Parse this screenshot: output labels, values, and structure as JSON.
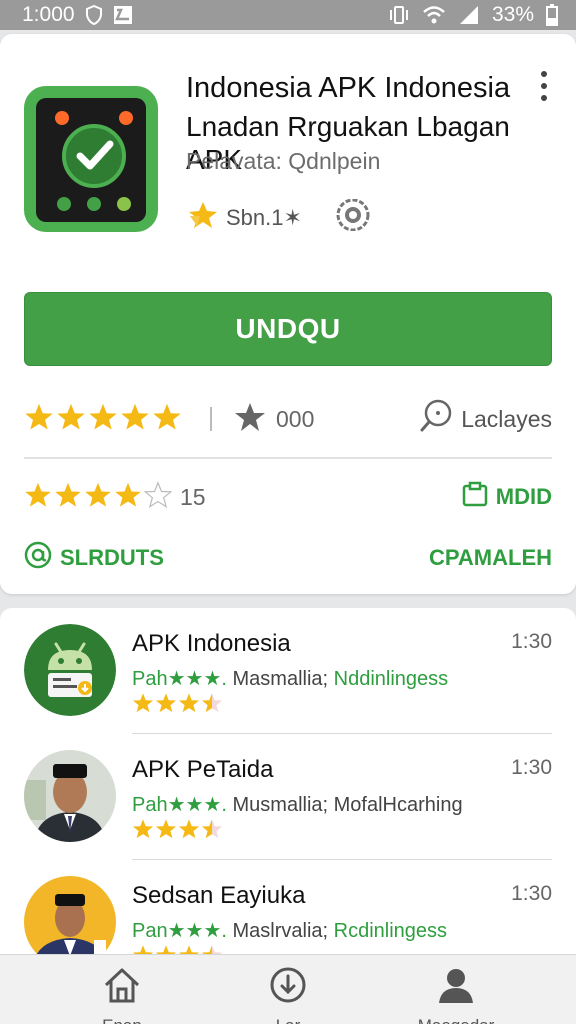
{
  "status_bar": {
    "time": "1:000",
    "battery": "33%"
  },
  "app": {
    "title": "Indonesia APK Indonesia",
    "subtitle": "Lnadan Rrguakan Lbagan APK",
    "publisher": "Pelavata:  Qdnlpein",
    "badge_text": "Sbn.1✶",
    "install_label": "UNDQU",
    "colors": {
      "accent": "#43a047",
      "link": "#2e9e3f",
      "star": "#f5b915"
    }
  },
  "ratings": {
    "primary_stars": 5,
    "primary_count": "000",
    "reviews_label": "Laclayes",
    "secondary_stars": 4,
    "secondary_count": "15",
    "right_link": "MDID",
    "left_link_2": "SLRDUTS",
    "right_link_2": "CPAMALEH"
  },
  "list": [
    {
      "title": "APK Indonesia",
      "time": "1:30",
      "meta_green": "Pah★★★.",
      "meta_mid": "Masmallia;",
      "meta_end": "Nddinlingess",
      "stars": 3.5,
      "avatar": "android-robot-icon"
    },
    {
      "title": "APK PeTaida",
      "time": "1:30",
      "meta_green": "Pah★★★.",
      "meta_mid": "Musmallia;",
      "meta_end": "MofalHcarhing",
      "stars": 3.5,
      "avatar": "person-portrait"
    },
    {
      "title": "Sedsan Eayiuka",
      "time": "1:30",
      "meta_green": "Pan★★★.",
      "meta_mid": "Maslrvalia;",
      "meta_end": "Rcdinlingess",
      "stars": 3.5,
      "avatar": "person-portrait"
    }
  ],
  "bottom_nav": [
    {
      "label": "Enap",
      "icon": "home-icon"
    },
    {
      "label": "Lar",
      "icon": "download-icon"
    },
    {
      "label": "Maegedar",
      "icon": "profile-icon"
    }
  ]
}
